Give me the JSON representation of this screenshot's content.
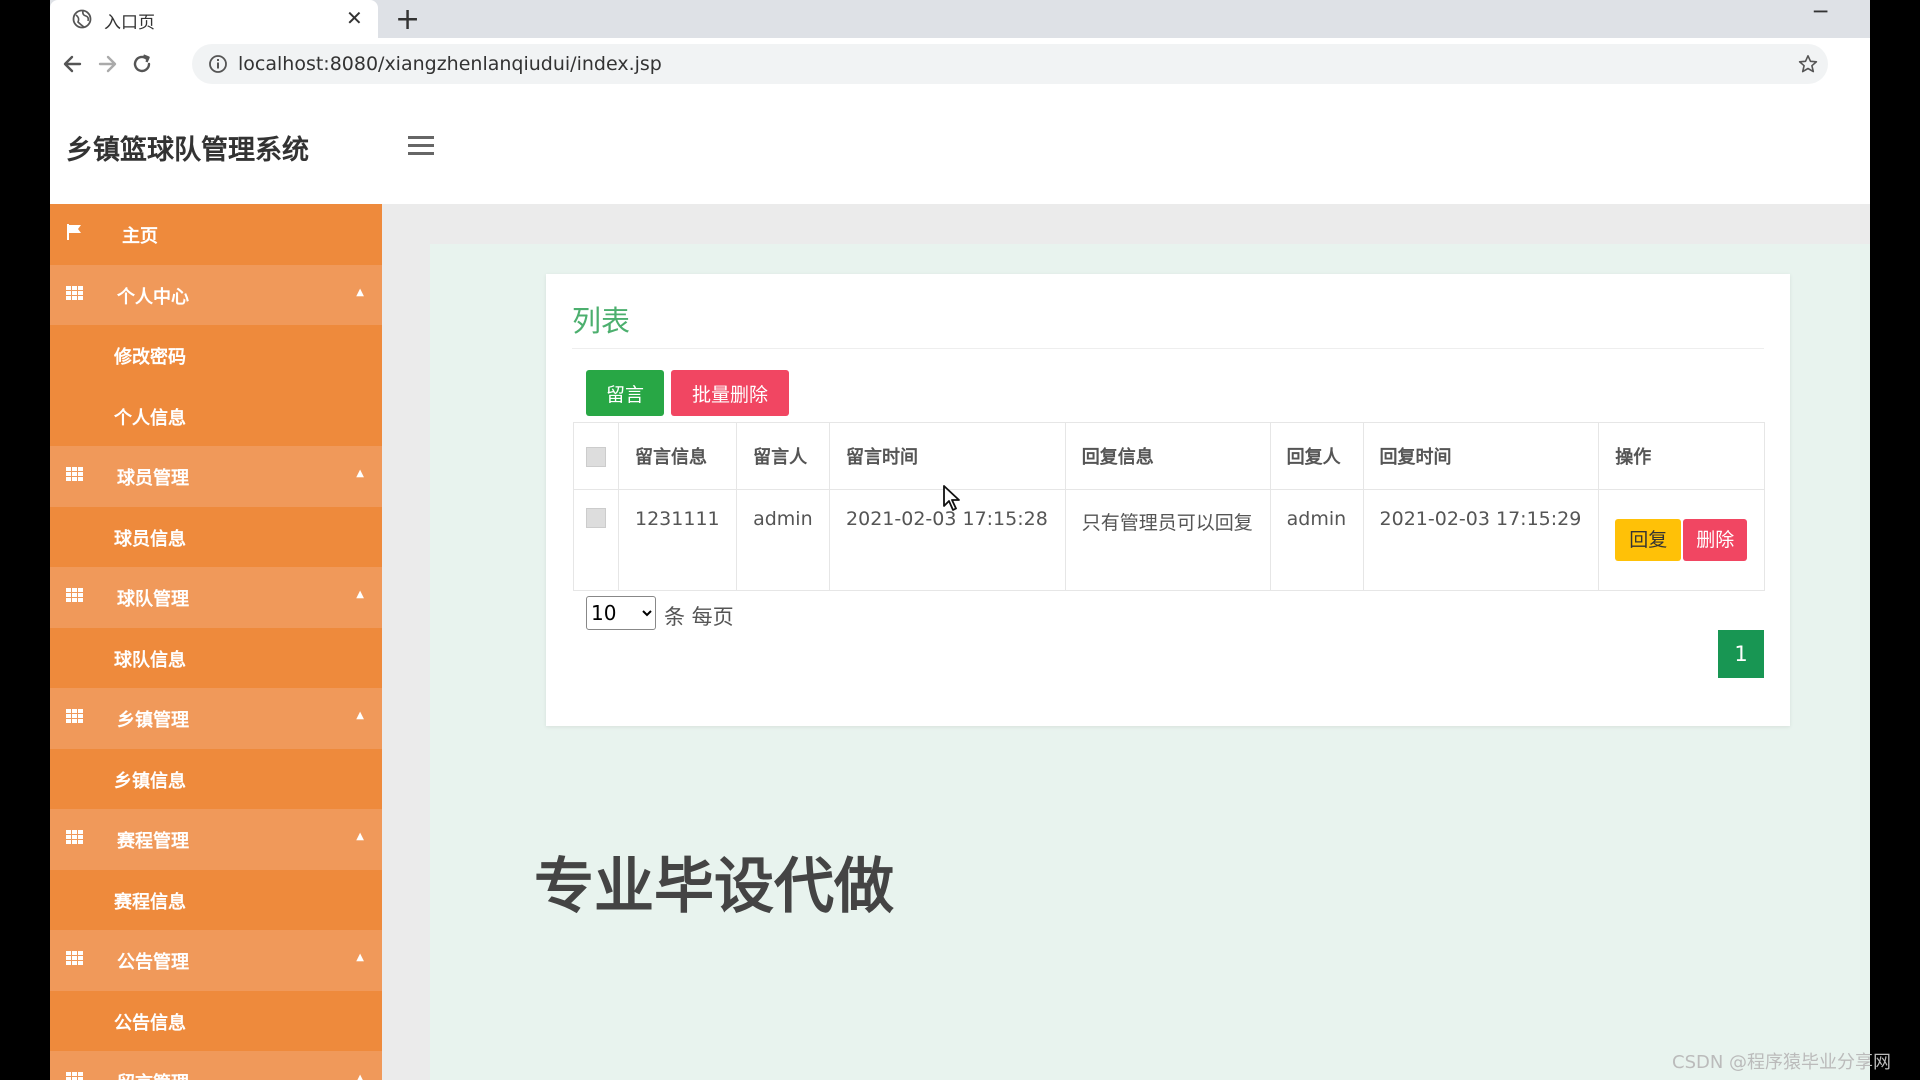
{
  "browser": {
    "tab_title": "入口页",
    "close_glyph": "✕",
    "newtab_glyph": "+",
    "minimize_glyph": "─",
    "url": "localhost:8080/xiangzhenlanqiudui/index.jsp"
  },
  "header": {
    "title": "乡镇篮球队管理系统"
  },
  "sidebar": {
    "home": "主页",
    "groups": [
      {
        "label": "个人中心",
        "items": [
          "修改密码",
          "个人信息"
        ]
      },
      {
        "label": "球员管理",
        "items": [
          "球员信息"
        ]
      },
      {
        "label": "球队管理",
        "items": [
          "球队信息"
        ]
      },
      {
        "label": "乡镇管理",
        "items": [
          "乡镇信息"
        ]
      },
      {
        "label": "赛程管理",
        "items": [
          "赛程信息"
        ]
      },
      {
        "label": "公告管理",
        "items": [
          "公告信息"
        ]
      },
      {
        "label": "留言管理",
        "items": []
      }
    ],
    "caret_glyph": "▲",
    "colors": {
      "item": "#ee8a3c",
      "group": "#f0995a"
    }
  },
  "panel": {
    "title": "列表",
    "add_label": "留言",
    "batch_delete_label": "批量删除",
    "columns": [
      "留言信息",
      "留言人",
      "留言时间",
      "回复信息",
      "回复人",
      "回复时间",
      "操作"
    ],
    "rows": [
      {
        "message": "1231111",
        "author": "admin",
        "time": "2021-02-03 17:15:28",
        "reply": "只有管理员可以回复",
        "replier": "admin",
        "reply_time": "2021-02-03 17:15:29",
        "reply_label": "回复",
        "delete_label": "删除"
      }
    ],
    "page_size": "10",
    "per_page_label": "条 每页",
    "current_page": "1"
  },
  "slogan": "专业毕设代做",
  "watermark": "CSDN @程序猿毕业分享网",
  "colors": {
    "accent_green": "#28a745",
    "danger": "#f14662",
    "warning": "#ffc107",
    "sidebar": "#ee8a3c"
  }
}
